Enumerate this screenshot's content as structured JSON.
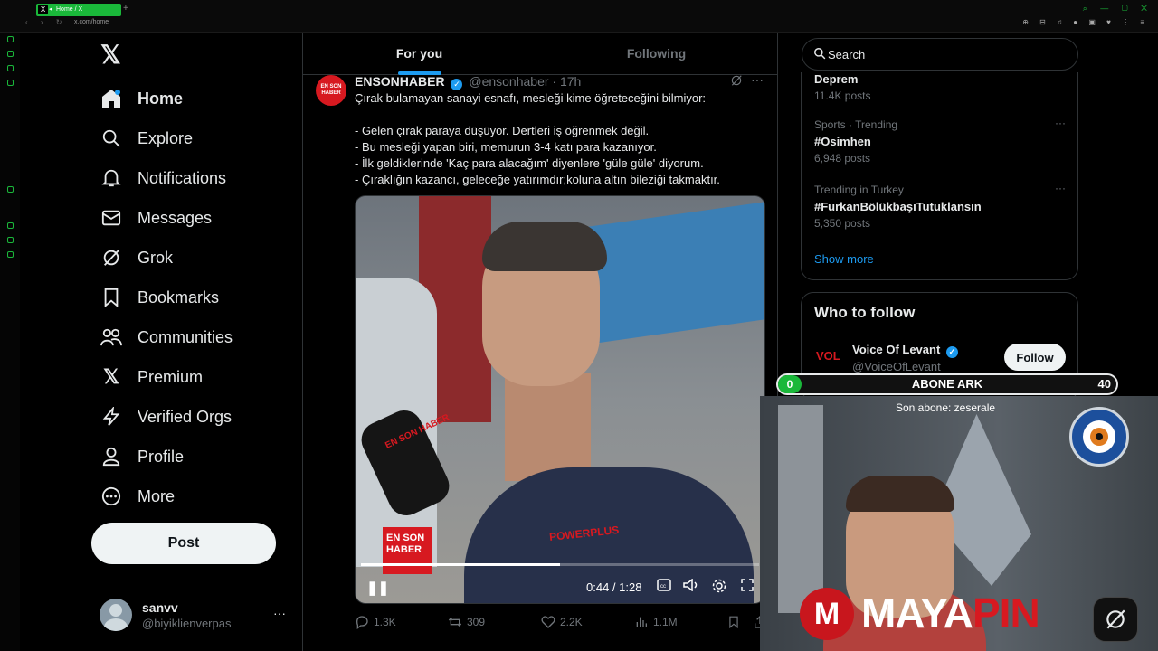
{
  "browser": {
    "tab_title": "Home / X",
    "url": "x.com/home"
  },
  "nav": {
    "items": [
      {
        "label": "Home",
        "icon": "home-icon"
      },
      {
        "label": "Explore",
        "icon": "search-icon"
      },
      {
        "label": "Notifications",
        "icon": "bell-icon"
      },
      {
        "label": "Messages",
        "icon": "envelope-icon"
      },
      {
        "label": "Grok",
        "icon": "grok-icon"
      },
      {
        "label": "Bookmarks",
        "icon": "bookmark-icon"
      },
      {
        "label": "Communities",
        "icon": "people-icon"
      },
      {
        "label": "Premium",
        "icon": "x-icon"
      },
      {
        "label": "Verified Orgs",
        "icon": "lightning-icon"
      },
      {
        "label": "Profile",
        "icon": "person-icon"
      },
      {
        "label": "More",
        "icon": "more-circle-icon"
      }
    ],
    "post_label": "Post"
  },
  "account": {
    "name": "sanvv",
    "handle": "@biyiklienverpas"
  },
  "feed": {
    "tab_for_you": "For you",
    "tab_following": "Following"
  },
  "tweet": {
    "name": "ENSONHABER",
    "handle": "@ensonhaber",
    "time": "· 17h",
    "avatar_text": "EN SON HABER",
    "text": "Çırak bulamayan sanayi esnafı, mesleği kime öğreteceğini bilmiyor:\n\n- Gelen çırak paraya düşüyor. Dertleri iş öğrenmek değil.\n- Bu mesleği yapan biri, memurun 3-4 katı para kazanıyor.\n- İlk geldiklerinde 'Kaç para alacağım' diyenlere 'güle güle' diyorum.\n- Çıraklığın kazancı, geleceğe yatırımdır;koluna altın bileziği takmaktır.",
    "video": {
      "time": "0:44 / 1:28",
      "progress": 0.5,
      "badge": "EN SON HABER",
      "mic_text": "EN SON HABER",
      "shirt_brand": "POWERPLUS"
    },
    "replies": "1.3K",
    "reposts": "309",
    "likes": "2.2K",
    "views": "1.1M"
  },
  "search": {
    "placeholder": "Search"
  },
  "trends": {
    "top_partial": {
      "title": "Deprem",
      "count": "11.4K posts"
    },
    "items": [
      {
        "meta": "Sports · Trending",
        "title": "#Osimhen",
        "count": "6,948 posts"
      },
      {
        "meta": "Trending in Turkey",
        "title": "#FurkanBölükbaşıTutuklansın",
        "count": "5,350 posts"
      }
    ],
    "show_more": "Show more"
  },
  "who_to_follow": {
    "title": "Who to follow",
    "name": "Voice Of Levant",
    "handle": "@VoiceOfLevant",
    "logo_text": "VOL",
    "follow_label": "Follow"
  },
  "overlay": {
    "bar_start": "0",
    "bar_label": "ABONE ARK",
    "bar_goal": "40",
    "last_sub": "Son abone: zeserale",
    "brand_white": "MAYA",
    "brand_red": "PIN",
    "logo_letter": "M"
  },
  "colors": {
    "accent": "#1d9bf0",
    "tab_green": "#1ab83a",
    "brand_red": "#d71920"
  }
}
